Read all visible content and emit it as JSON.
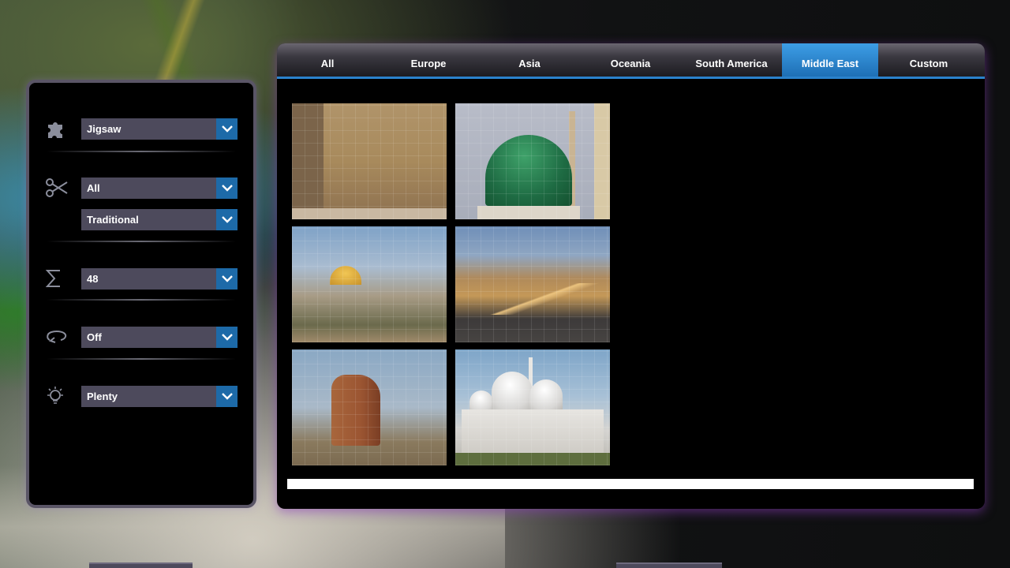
{
  "settings": {
    "puzzle_type": "Jigsaw",
    "cut_set": "All",
    "cut_style": "Traditional",
    "piece_count": "48",
    "rotation": "Off",
    "hints": "Plenty"
  },
  "tabs": [
    {
      "label": "All",
      "active": false
    },
    {
      "label": "Europe",
      "active": false
    },
    {
      "label": "Asia",
      "active": false
    },
    {
      "label": "Oceania",
      "active": false
    },
    {
      "label": "South America",
      "active": false
    },
    {
      "label": "Middle East",
      "active": true
    },
    {
      "label": "Custom",
      "active": false
    }
  ],
  "colors": {
    "accent": "#1d6aa8",
    "tab_active": "#2b82cc",
    "dropdown_bg": "#4d4a5c",
    "panel_glow": "#8c3cbe"
  },
  "icons": {
    "puzzle_type": "puzzle-piece-icon",
    "cut": "scissors-icon",
    "pieces": "sigma-icon",
    "rotation": "rotate-icon",
    "hints": "lightbulb-icon"
  }
}
